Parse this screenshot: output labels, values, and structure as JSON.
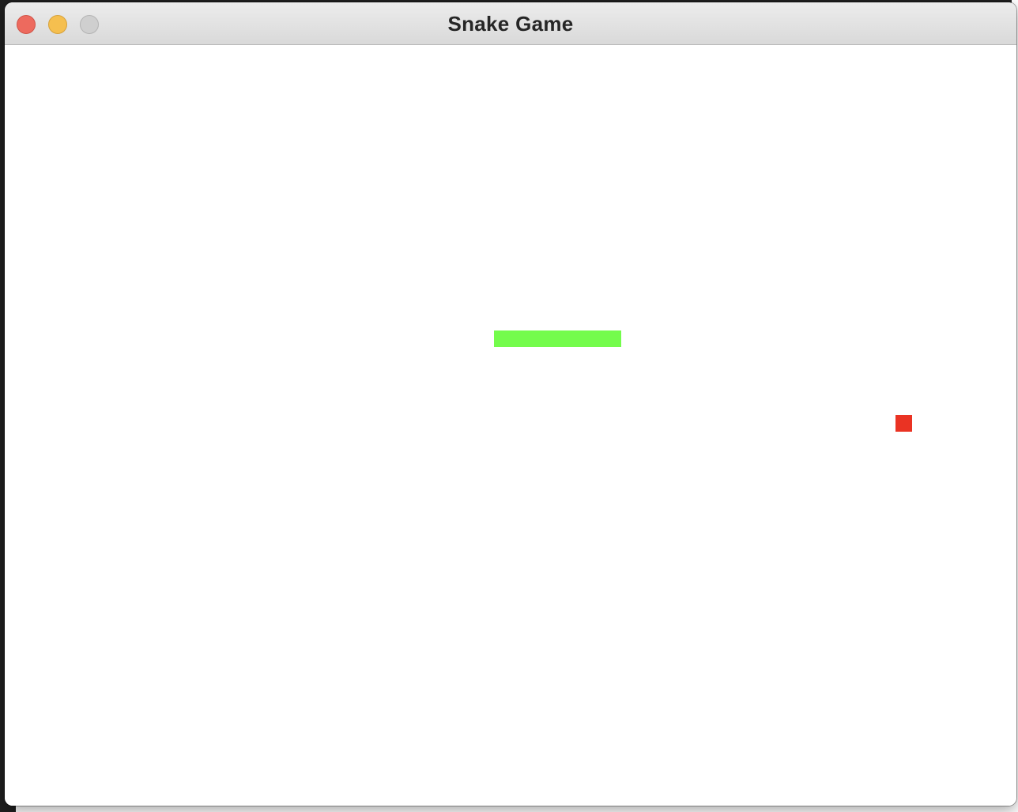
{
  "window": {
    "title": "Snake Game"
  },
  "colors": {
    "snake": "#74fc4c",
    "food": "#ea3323",
    "board": "#ffffff",
    "close_button": "#ed6a5e",
    "minimize_button": "#f5bf4f",
    "zoom_button": "#cfcfcf"
  },
  "icons": {
    "close": "close-icon",
    "minimize": "minimize-icon",
    "zoom": "zoom-icon"
  }
}
